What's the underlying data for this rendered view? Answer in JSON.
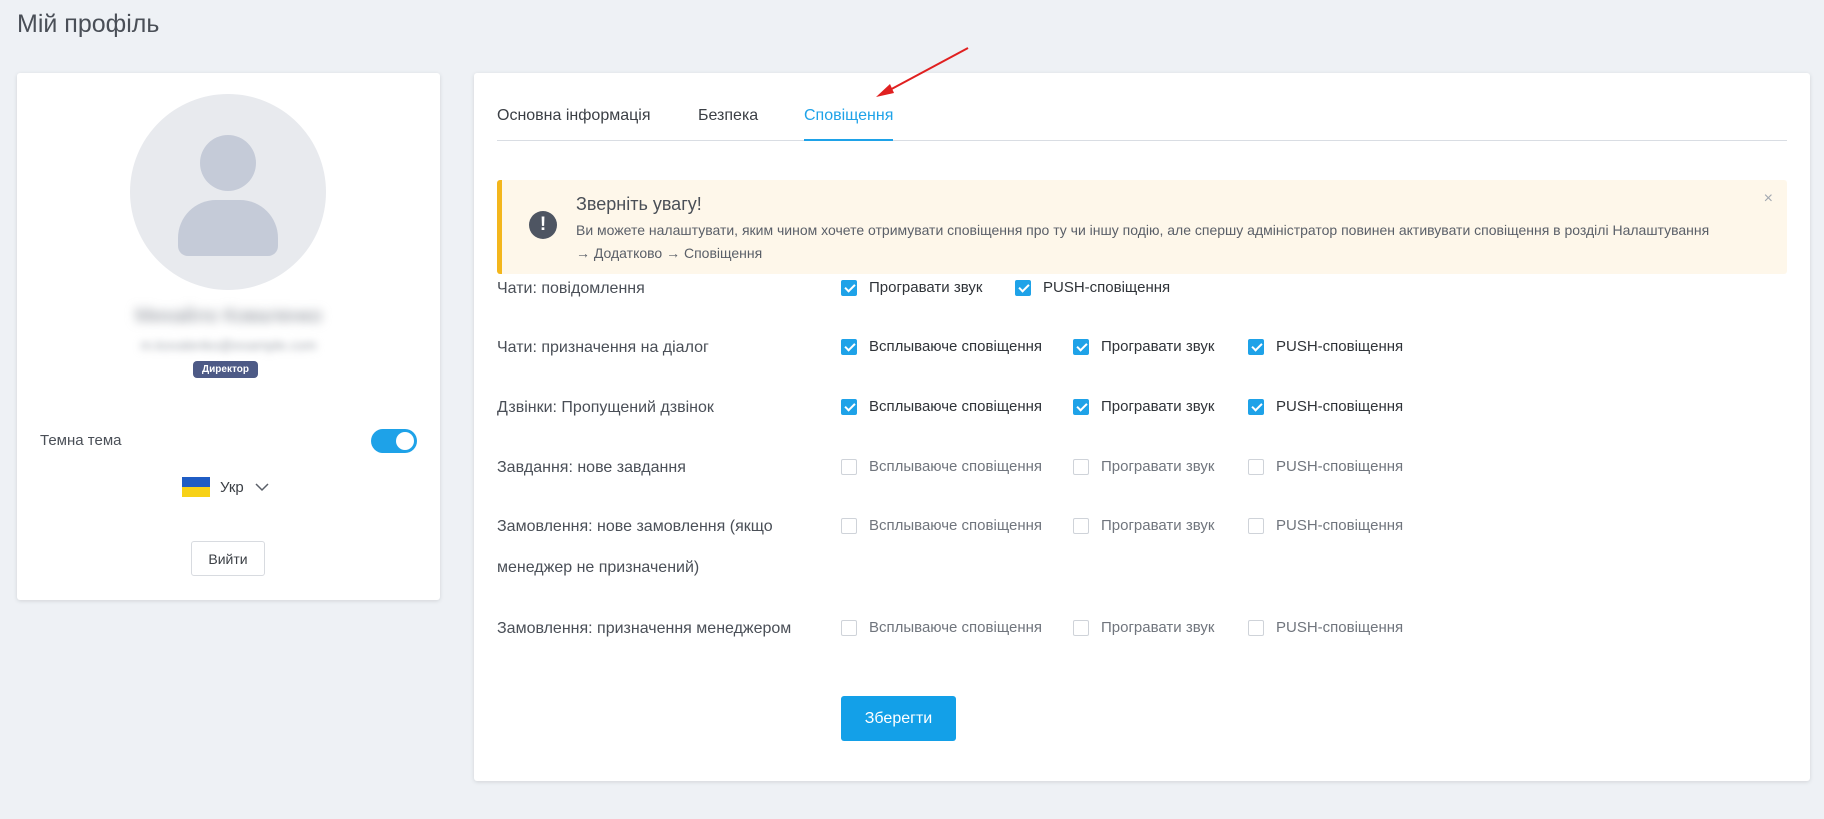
{
  "page_title": "Мій профіль",
  "profile": {
    "name": "Михайло Коваленко",
    "email": "m.kovalenko@example.com",
    "role": "Директор",
    "theme_label": "Темна тема",
    "dark_theme_on": true,
    "language": "Укр",
    "logout_label": "Вийти"
  },
  "tabs": [
    "Основна інформація",
    "Безпека",
    "Сповіщення"
  ],
  "active_tab": "Сповіщення",
  "alert": {
    "title": "Зверніть увагу!",
    "text": "Ви можете налаштувати, яким чином хочете отримувати сповіщення про ту чи іншу подію, але спершу адміністратор повинен активувати сповіщення в розділі Налаштування → Додатково → Сповіщення",
    "close": "×",
    "icon": "!"
  },
  "option_labels": {
    "popup": "Всплываюче сповіщення",
    "sound": "Програвати звук",
    "push": "PUSH-сповіщення"
  },
  "settings": [
    {
      "label": "Чати: повідомлення",
      "options": [
        {
          "type": "sound",
          "checked": true
        },
        {
          "type": "push",
          "checked": true
        }
      ]
    },
    {
      "label": "Чати: призначення на діалог",
      "options": [
        {
          "type": "popup",
          "checked": true
        },
        {
          "type": "sound",
          "checked": true
        },
        {
          "type": "push",
          "checked": true
        }
      ]
    },
    {
      "label": "Дзвінки: Пропущений дзвінок",
      "options": [
        {
          "type": "popup",
          "checked": true
        },
        {
          "type": "sound",
          "checked": true
        },
        {
          "type": "push",
          "checked": true
        }
      ]
    },
    {
      "label": "Завдання: нове завдання",
      "options": [
        {
          "type": "popup",
          "checked": false
        },
        {
          "type": "sound",
          "checked": false
        },
        {
          "type": "push",
          "checked": false
        }
      ]
    },
    {
      "label": "Замовлення: нове замовлення (якщо менеджер не призначений)",
      "options": [
        {
          "type": "popup",
          "checked": false
        },
        {
          "type": "sound",
          "checked": false
        },
        {
          "type": "push",
          "checked": false
        }
      ]
    },
    {
      "label": "Замовлення: призначення менеджером",
      "options": [
        {
          "type": "popup",
          "checked": false
        },
        {
          "type": "sound",
          "checked": false
        },
        {
          "type": "push",
          "checked": false
        }
      ]
    }
  ],
  "save_label": "Зберегти",
  "colors": {
    "accent": "#1ea2e8",
    "alert_border": "#f3b61c",
    "alert_bg": "#fef7ea",
    "annotation_arrow": "#e02020"
  }
}
